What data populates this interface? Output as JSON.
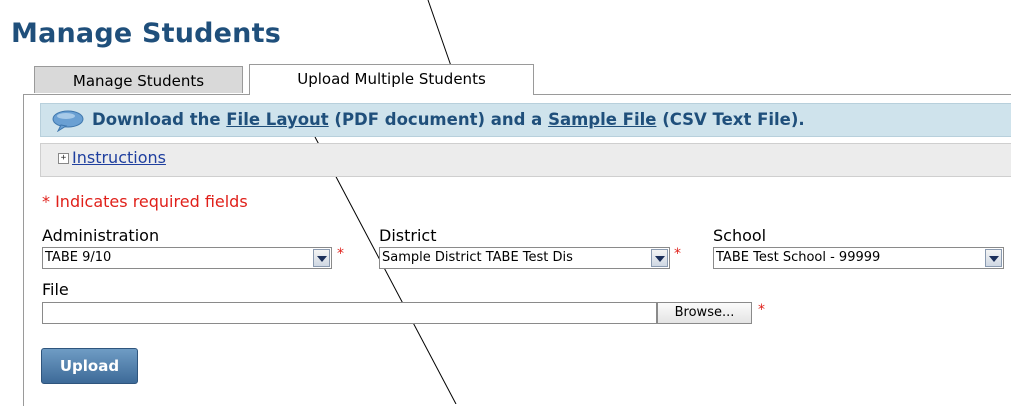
{
  "page": {
    "title": "Manage Students"
  },
  "tabs": [
    {
      "label": "Manage Students",
      "active": false
    },
    {
      "label": "Upload Multiple Students",
      "active": true
    }
  ],
  "download": {
    "prefix": "Download the ",
    "file_layout_link": "File Layout",
    "middle": " (PDF document) and a ",
    "sample_file_link": "Sample File",
    "suffix": " (CSV Text File)."
  },
  "instructions": {
    "expand_symbol": "+",
    "label": "Instructions"
  },
  "required_note": "* Indicates required fields",
  "form": {
    "administration": {
      "label": "Administration",
      "value": "TABE 9/10"
    },
    "district": {
      "label": "District",
      "value": "Sample District TABE Test Dis"
    },
    "school": {
      "label": "School",
      "value": "TABE Test School - 99999"
    },
    "file": {
      "label": "File",
      "value": "",
      "browse_label": "Browse..."
    },
    "required_mark": "*"
  },
  "upload_button": "Upload",
  "colors": {
    "title": "#1f4f7b",
    "info_bar": "#cfe3ec",
    "required": "#e0201a",
    "upload_button": "#4a76a3"
  },
  "icons": {
    "download_bar": "speech-bubble-icon",
    "instructions": "plus-box-icon",
    "select": "chevron-down-icon"
  }
}
